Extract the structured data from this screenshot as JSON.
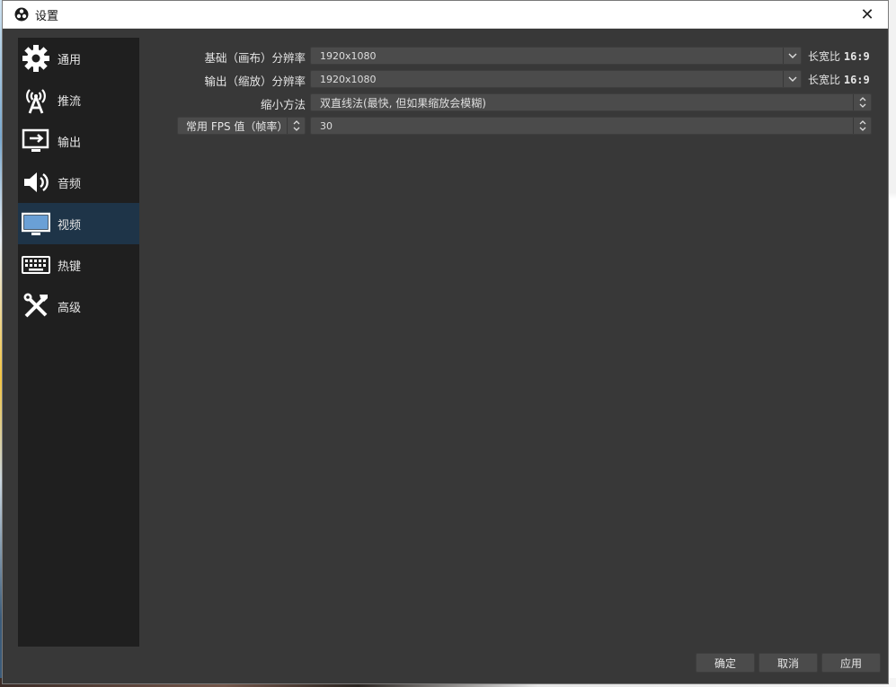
{
  "window": {
    "title": "设置",
    "close_glyph": "✕"
  },
  "sidebar": {
    "items": [
      {
        "label": "通用",
        "icon": "gear-icon"
      },
      {
        "label": "推流",
        "icon": "antenna-icon"
      },
      {
        "label": "输出",
        "icon": "output-monitor-icon"
      },
      {
        "label": "音频",
        "icon": "speaker-icon"
      },
      {
        "label": "视频",
        "icon": "monitor-icon",
        "active": true
      },
      {
        "label": "热键",
        "icon": "keyboard-icon"
      },
      {
        "label": "高级",
        "icon": "tools-icon"
      }
    ]
  },
  "video": {
    "base_label": "基础（画布）分辨率",
    "base_value": "1920x1080",
    "base_ratio_label": "长宽比",
    "base_ratio_value": "16:9",
    "output_label": "输出（缩放）分辨率",
    "output_value": "1920x1080",
    "output_ratio_label": "长宽比",
    "output_ratio_value": "16:9",
    "downscale_label": "缩小方法",
    "downscale_value": "双直线法(最快, 但如果缩放会模糊)",
    "fps_type": "常用 FPS 值（帧率）",
    "fps_value": "30"
  },
  "footer": {
    "ok": "确定",
    "cancel": "取消",
    "apply": "应用"
  },
  "colors": {
    "window_bg": "#383838",
    "sidebar_bg": "#1f1f1f",
    "active_item": "#1e3448",
    "input_bg": "#4b4b4b"
  }
}
